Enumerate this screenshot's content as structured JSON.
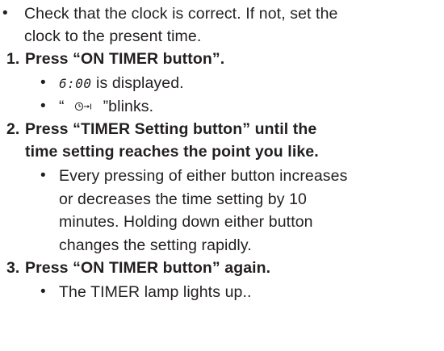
{
  "intro": {
    "bullet": "•",
    "line1": "Check that the clock is correct. If not, set the",
    "line2": "clock to the present time."
  },
  "steps": [
    {
      "number": "1.",
      "title_lines": [
        "Press “ON TIMER button”."
      ],
      "bullets": [
        {
          "display_value": "6:00",
          "text": " is displayed."
        },
        {
          "open_quote": "“",
          "icon": "timer-on-icon",
          "text": "”blinks."
        }
      ]
    },
    {
      "number": "2.",
      "title_lines": [
        "Press “TIMER Setting button” until the",
        "time setting reaches the point you like."
      ],
      "bullets": [
        {
          "lines": [
            "Every pressing of either button increases",
            "or decreases the time setting by 10",
            "minutes. Holding down either button",
            "changes the setting rapidly."
          ]
        }
      ]
    },
    {
      "number": "3.",
      "title_lines": [
        "Press “ON TIMER button” again."
      ],
      "bullets": [
        {
          "text": "The TIMER lamp lights up.."
        }
      ]
    }
  ],
  "colors": {
    "text": "#231f20",
    "background": "#ffffff"
  }
}
